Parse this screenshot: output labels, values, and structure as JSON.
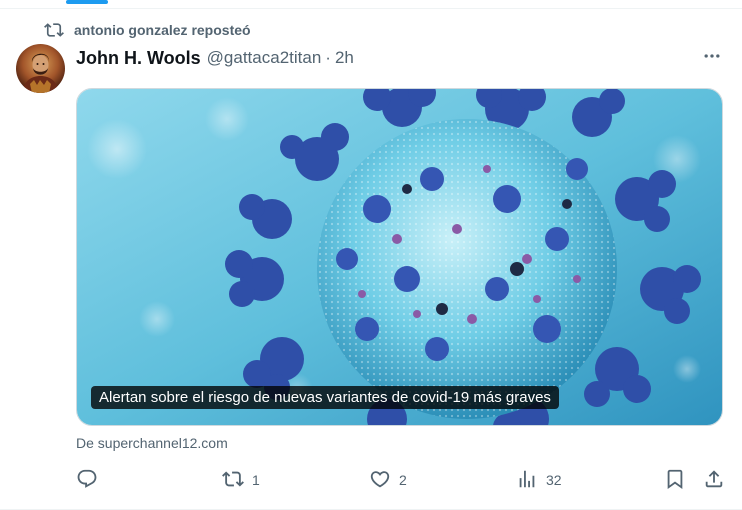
{
  "repost": {
    "label": "antonio gonzalez reposteó",
    "icon": "repost-icon"
  },
  "tweet": {
    "author_name": "John H. Wools",
    "handle": "@gattaca2titan",
    "separator": "·",
    "time": "2h"
  },
  "media": {
    "caption": "Alertan sobre el riesgo de nuevas variantes de covid-19 más graves"
  },
  "source": "De superchannel12.com",
  "actions": {
    "reply": {
      "icon": "reply-icon"
    },
    "repost": {
      "count": "1",
      "icon": "repost-icon"
    },
    "like": {
      "count": "2",
      "icon": "heart-icon"
    },
    "views": {
      "count": "32",
      "icon": "views-icon"
    },
    "bookmark": {
      "icon": "bookmark-icon"
    },
    "share": {
      "icon": "share-icon"
    }
  },
  "colors": {
    "accent": "#1d9bf0",
    "text_secondary": "#536471",
    "text_primary": "#0f1419"
  }
}
